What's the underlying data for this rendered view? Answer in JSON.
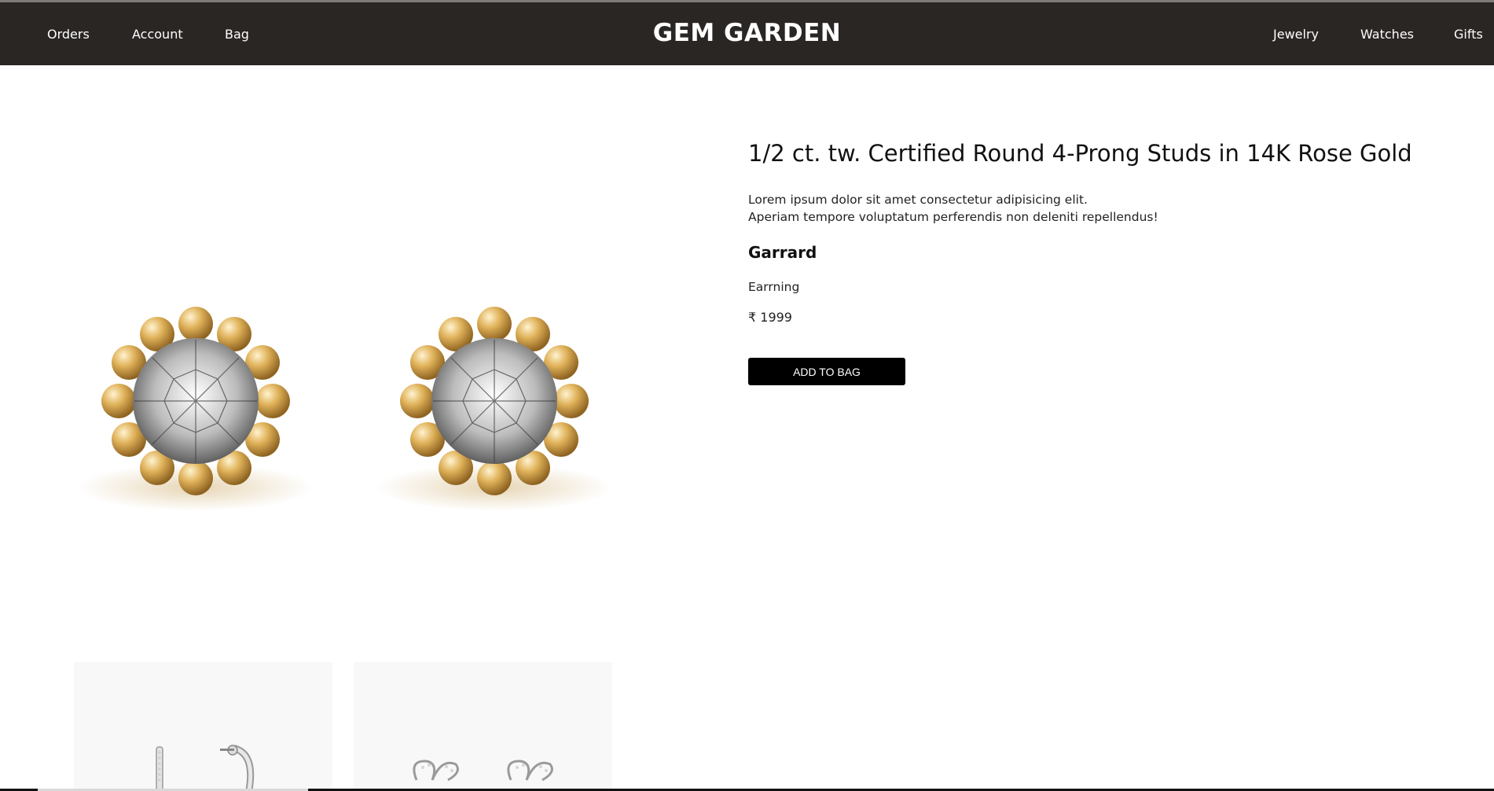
{
  "header": {
    "brand": "GEM GARDEN",
    "left_links": [
      "Orders",
      "Account",
      "Bag"
    ],
    "right_links": [
      "Jewelry",
      "Watches",
      "Gifts"
    ],
    "background": "#2a2624"
  },
  "product": {
    "title": "1/2 ct. tw. Certified Round 4-Prong Studs in 14K Rose Gold",
    "description_line1": "Lorem ipsum dolor sit amet consectetur adipisicing elit.",
    "description_line2": "Aperiam tempore voluptatum perferendis non deleniti repellendus!",
    "brand": "Garrard",
    "category": "Earrning",
    "price": "₹ 1999",
    "add_to_bag_label": "ADD TO BAG",
    "image_icon": "gold-diamond-stud-earrings"
  },
  "related": {
    "thumbnails": [
      {
        "icon": "silver-hoop-earrings"
      },
      {
        "icon": "silver-butterfly-earrings"
      }
    ]
  },
  "colors": {
    "nav_bg": "#2a2624",
    "button_bg": "#000000",
    "gold": "#d9a94e"
  }
}
